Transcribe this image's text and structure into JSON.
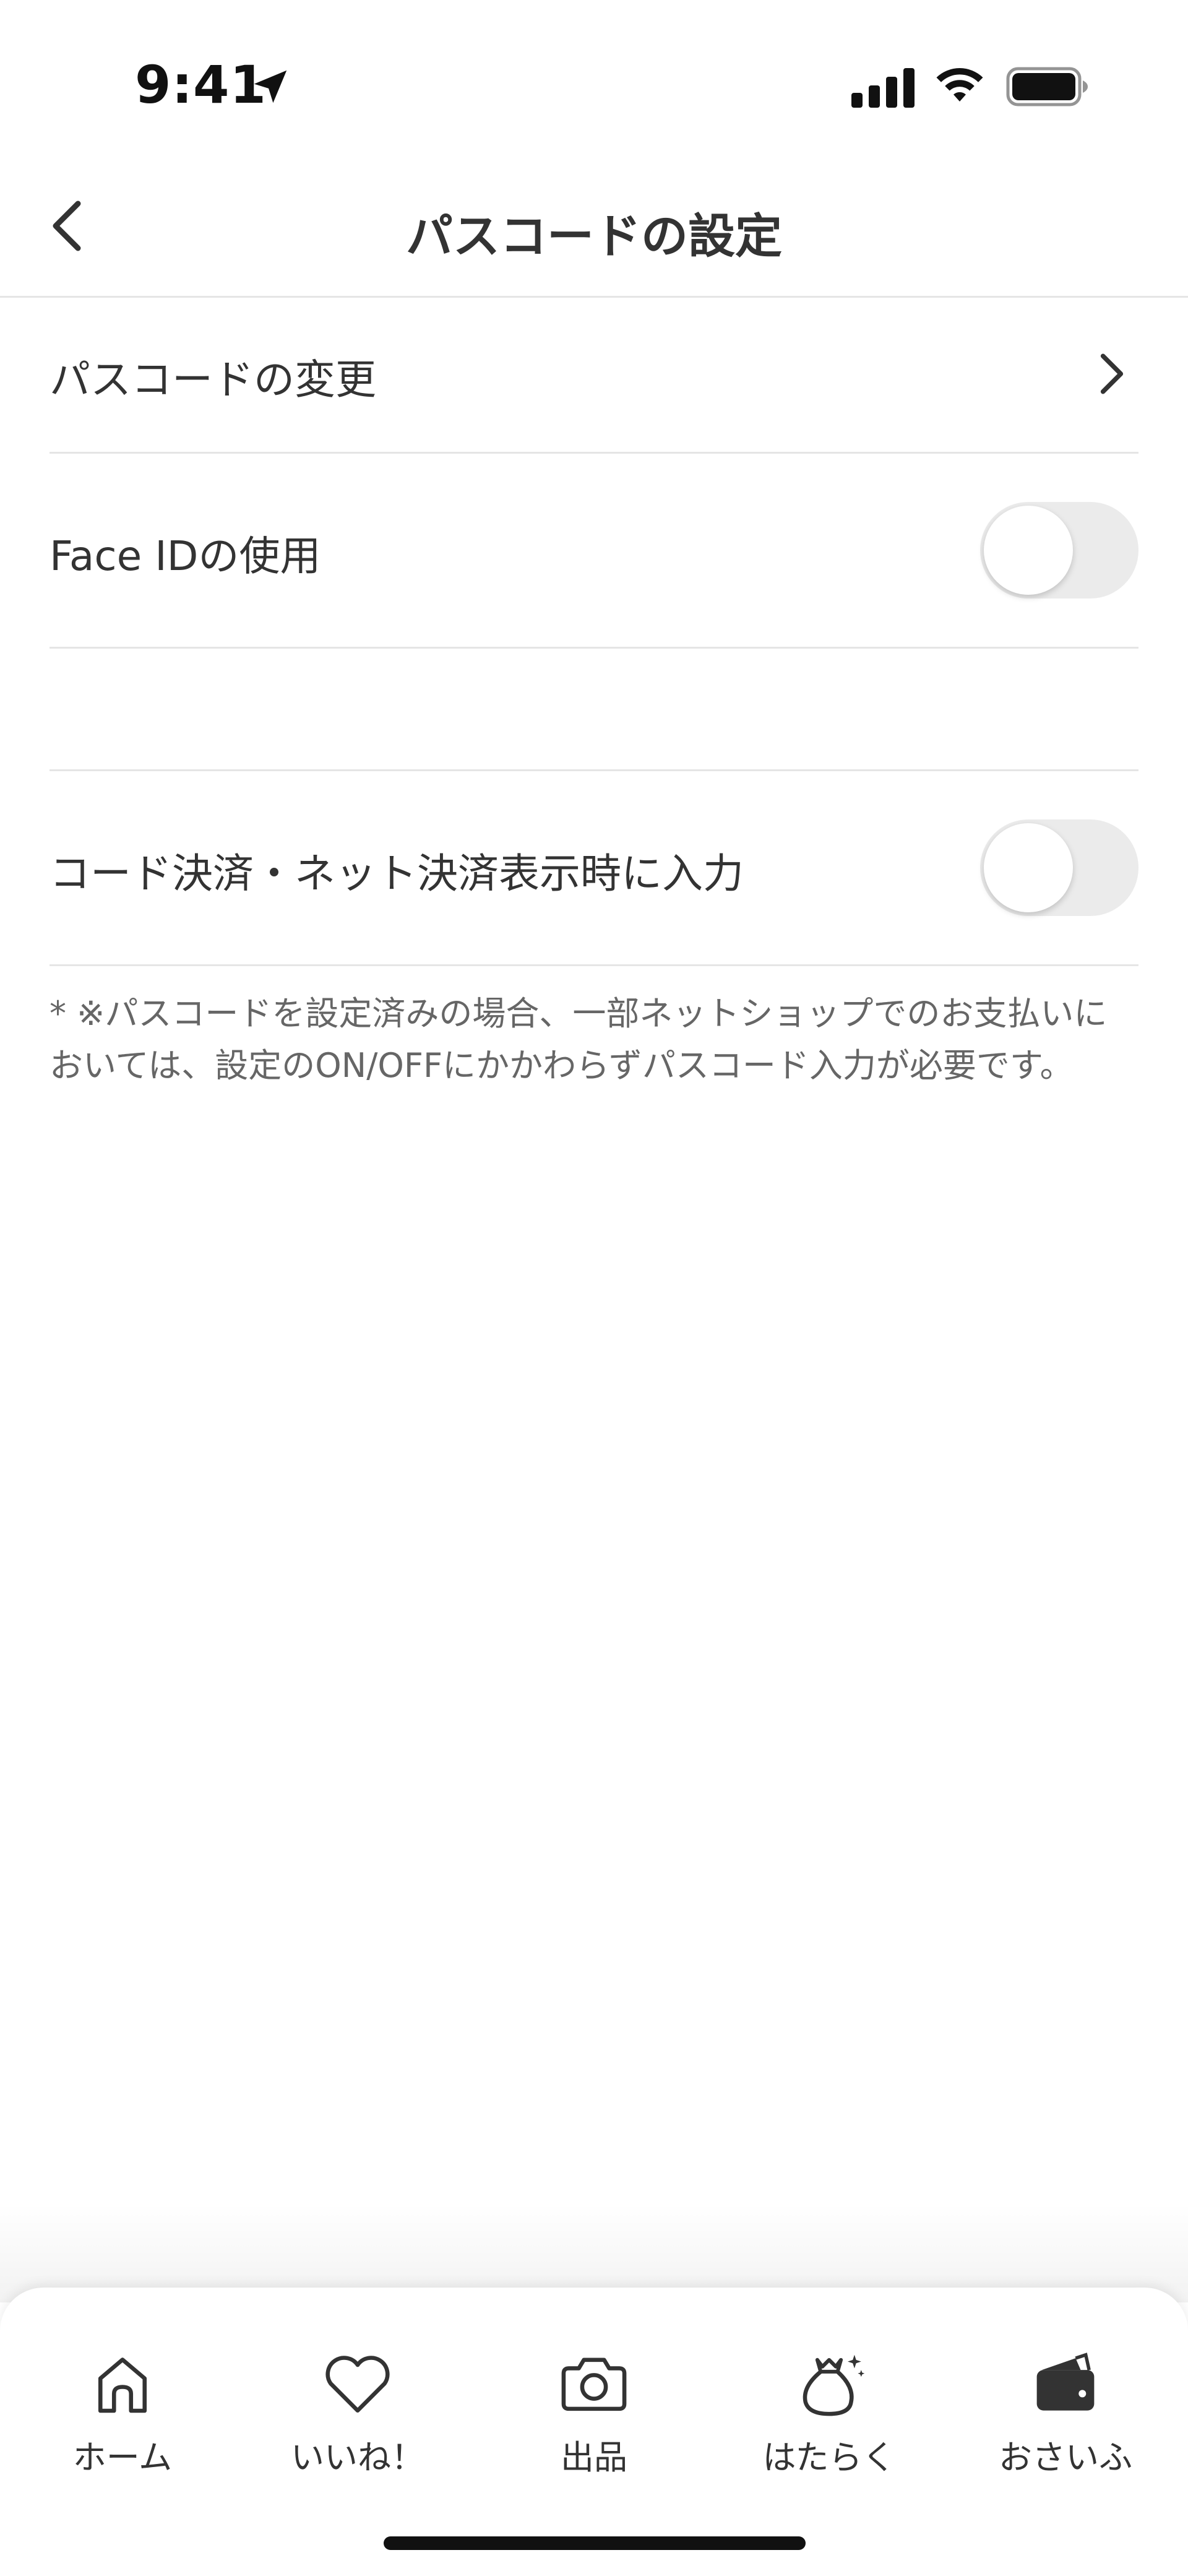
{
  "status_bar": {
    "time": "9:41"
  },
  "nav": {
    "title": "パスコードの設定"
  },
  "rows": {
    "change_passcode": {
      "label": "パスコードの変更"
    },
    "face_id": {
      "label": "Face IDの使用",
      "enabled": false
    },
    "code_payment": {
      "label": "コード決済・ネット決済表示時に入力",
      "enabled": false
    }
  },
  "note": {
    "line1": "* ※パスコードを設定済みの場合、一部ネットショップでのお支払いに",
    "line2": "おいては、設定のON/OFFにかかわらずパスコード入力が必要です。"
  },
  "tabs": [
    {
      "label": "ホーム",
      "icon": "home-icon"
    },
    {
      "label": "いいね！",
      "icon": "heart-icon"
    },
    {
      "label": "出品",
      "icon": "camera-icon"
    },
    {
      "label": "はたらく",
      "icon": "money-bag-icon"
    },
    {
      "label": "おさいふ",
      "icon": "wallet-icon"
    }
  ]
}
